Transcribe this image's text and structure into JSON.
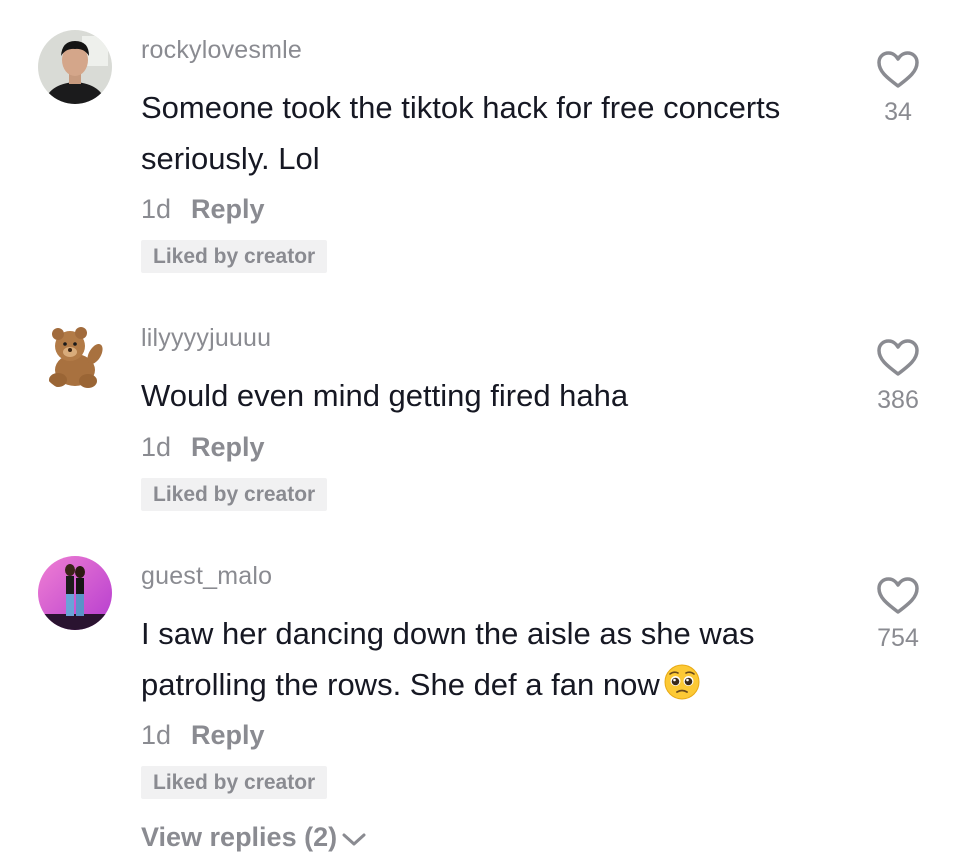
{
  "comments": [
    {
      "username": "rockylovesmle",
      "text": "Someone took the tiktok hack for free concerts seriously. Lol",
      "age": "1d",
      "reply_label": "Reply",
      "liked_badge": "Liked by creator",
      "like_count": "34",
      "like_icon": "heart-outline-icon"
    },
    {
      "username": "lilyyyyjuuuu",
      "text": "Would even mind getting fired haha",
      "age": "1d",
      "reply_label": "Reply",
      "liked_badge": "Liked by creator",
      "like_count": "386",
      "like_icon": "heart-outline-icon"
    },
    {
      "username": "guest_malo",
      "text": "I saw her dancing down the aisle as she was patrolling the rows. She def a fan now",
      "text_emoji": "pleading-face-emoji",
      "age": "1d",
      "reply_label": "Reply",
      "liked_badge": "Liked by creator",
      "like_count": "754",
      "like_icon": "heart-outline-icon"
    }
  ],
  "view_replies": {
    "label": "View replies (2)",
    "icon": "chevron-down-icon"
  },
  "colors": {
    "primary_text": "#161823",
    "secondary_text": "#8a8b91",
    "badge_bg": "#f1f1f2"
  }
}
